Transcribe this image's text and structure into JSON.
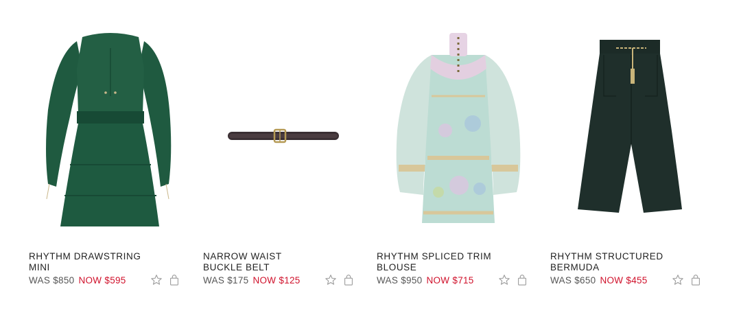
{
  "products": [
    {
      "title": "RHYTHM DRAWSTRING MINI",
      "was": "WAS $850",
      "now": "NOW $595",
      "image": "rhythm-drawstring-mini-dress-image"
    },
    {
      "title": "NARROW WAIST BUCKLE BELT",
      "was": "WAS $175",
      "now": "NOW $125",
      "image": "narrow-waist-buckle-belt-image"
    },
    {
      "title": "RHYTHM SPLICED TRIM BLOUSE",
      "was": "WAS $950",
      "now": "NOW $715",
      "image": "rhythm-spliced-trim-blouse-image"
    },
    {
      "title": "RHYTHM STRUCTURED BERMUDA",
      "was": "WAS $650",
      "now": "NOW $455",
      "image": "rhythm-structured-bermuda-image"
    }
  ],
  "icons": {
    "wishlist": "star-icon",
    "bag": "shopping-bag-icon"
  },
  "colors": {
    "sale_price": "#d0112b",
    "regular_price": "#555555",
    "icon": "#9a9a9a"
  }
}
